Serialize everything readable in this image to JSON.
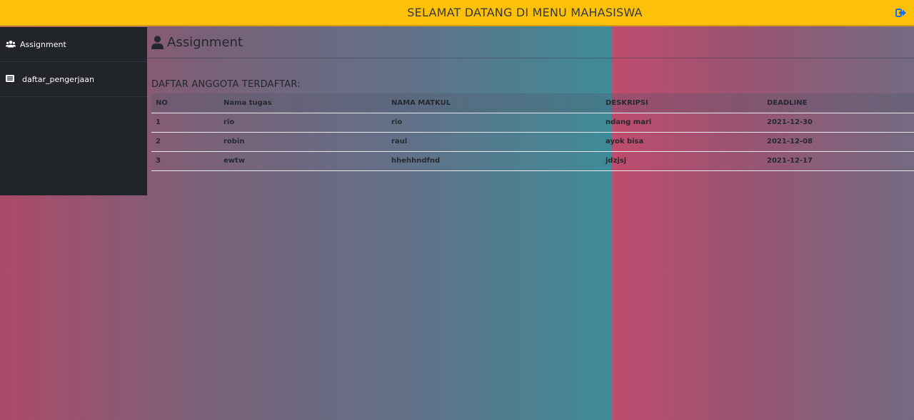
{
  "header": {
    "title": "SELAMAT DATANG DI MENU MAHASISWA",
    "logout_icon": "sign-out-icon",
    "bg_color": "#ffc107"
  },
  "sidebar": {
    "items": [
      {
        "label": "Assignment",
        "icon": "users-icon"
      },
      {
        "label": "daftar_pengerjaan",
        "icon": "list-icon"
      }
    ]
  },
  "main": {
    "heading": "Assignment",
    "heading_icon": "user-icon",
    "subtitle": "DAFTAR ANGGOTA TERDAFTAR:",
    "table": {
      "headers": [
        "NO",
        "Nama tugas",
        "NAMA MATKUL",
        "DESKRIPSI",
        "DEADLINE"
      ],
      "rows": [
        [
          "1",
          "rio",
          "rio",
          "ndang mari",
          "2021-12-30"
        ],
        [
          "2",
          "robin",
          "raul",
          "ayok bisa",
          "2021-12-08"
        ],
        [
          "3",
          "ewtw",
          "hhehhndfnd",
          "jdzjsj",
          "2021-12-17"
        ]
      ]
    }
  }
}
